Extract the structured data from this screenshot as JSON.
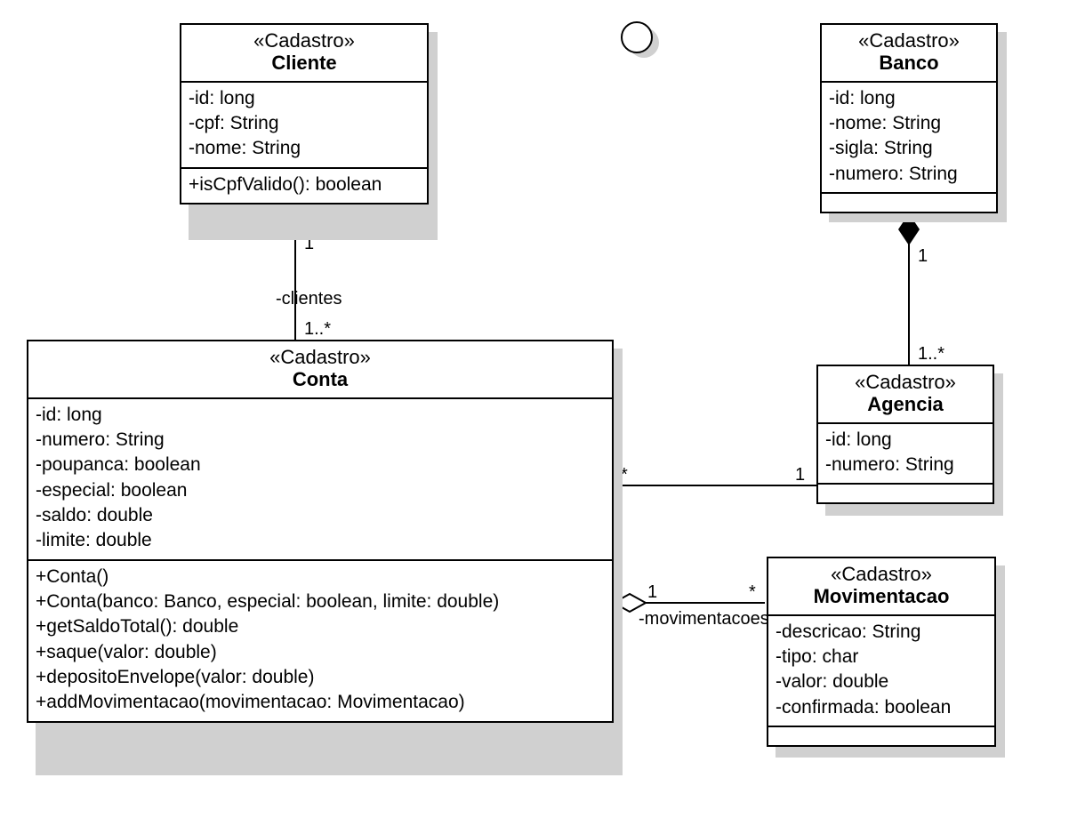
{
  "stereotype": "«Cadastro»",
  "classes": {
    "cliente": {
      "name": "Cliente",
      "attrs": [
        "-id: long",
        "-cpf: String",
        "-nome: String"
      ],
      "ops": [
        "+isCpfValido(): boolean"
      ]
    },
    "banco": {
      "name": "Banco",
      "attrs": [
        "-id: long",
        "-nome: String",
        "-sigla: String",
        "-numero: String"
      ],
      "ops": []
    },
    "conta": {
      "name": "Conta",
      "attrs": [
        "-id: long",
        "-numero: String",
        "-poupanca: boolean",
        "-especial: boolean",
        "-saldo: double",
        "-limite: double"
      ],
      "ops": [
        "+Conta()",
        "+Conta(banco: Banco, especial: boolean, limite: double)",
        "+getSaldoTotal(): double",
        "+saque(valor: double)",
        "+depositoEnvelope(valor: double)",
        "+addMovimentacao(movimentacao: Movimentacao)"
      ]
    },
    "agencia": {
      "name": "Agencia",
      "attrs": [
        "-id: long",
        "-numero: String"
      ],
      "ops": []
    },
    "movimentacao": {
      "name": "Movimentacao",
      "attrs": [
        "-descricao: String",
        "-tipo: char",
        "-valor: double",
        "-confirmada: boolean"
      ],
      "ops": []
    }
  },
  "relations": {
    "cliente_conta": {
      "from": "Cliente",
      "to": "Conta",
      "mult_from": "1",
      "mult_to": "1..*",
      "role_to": "-clientes",
      "type": "association"
    },
    "banco_agencia": {
      "from": "Banco",
      "to": "Agencia",
      "mult_from": "1",
      "mult_to": "1..*",
      "type": "composition"
    },
    "agencia_conta": {
      "from": "Agencia",
      "to": "Conta",
      "mult_from": "1",
      "mult_to": "*",
      "type": "association"
    },
    "conta_mov": {
      "from": "Conta",
      "to": "Movimentacao",
      "mult_from": "1",
      "mult_to": "*",
      "role_to": "-movimentacoes",
      "type": "aggregation"
    }
  }
}
